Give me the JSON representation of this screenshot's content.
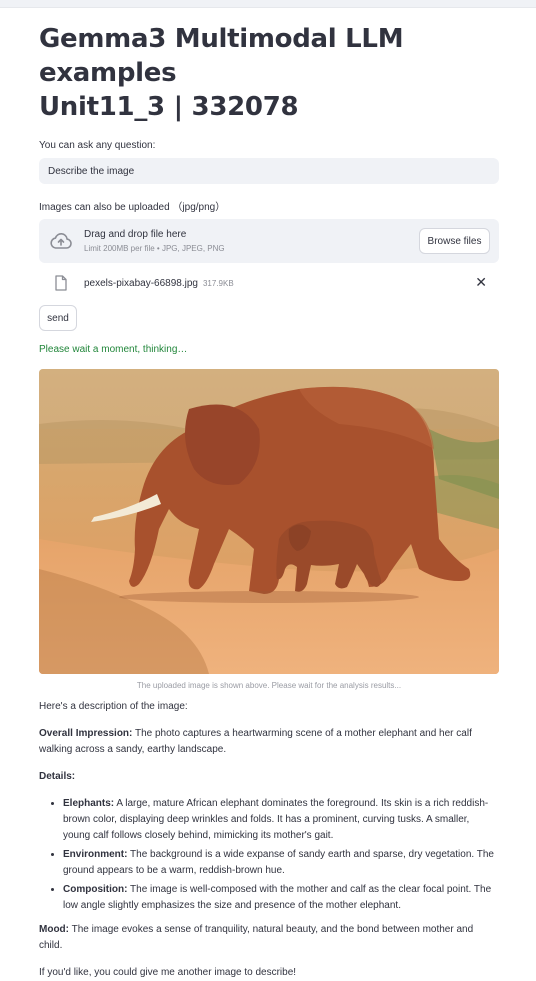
{
  "header": {
    "title_line1": "Gemma3 Multimodal LLM examples",
    "title_line2": "Unit11_3 | 332078"
  },
  "question": {
    "label": "You can ask any question:",
    "value": "Describe the image"
  },
  "uploader": {
    "label": "Images can also be uploaded （jpg/png）",
    "drag_text": "Drag and drop file here",
    "limit_text": "Limit 200MB per file • JPG, JPEG, PNG",
    "browse_label": "Browse files",
    "file_name": "pexels-pixabay-66898.jpg",
    "file_size": "317.9KB",
    "cloud_icon": "cloud-upload-icon",
    "file_icon": "file-icon",
    "close_icon": "close-icon"
  },
  "send_label": "send",
  "status_text": "Please wait a moment, thinking…",
  "image_caption": "The uploaded image is shown above. Please wait for the analysis results...",
  "response": {
    "intro": "Here's a description of the image:",
    "overall_label": "Overall Impression:",
    "overall_text": " The photo captures a heartwarming scene of a mother elephant and her calf walking across a sandy, earthy landscape.",
    "details_label": "Details:",
    "bullets": [
      {
        "label": "Elephants:",
        "text": " A large, mature African elephant dominates the foreground. Its skin is a rich reddish-brown color, displaying deep wrinkles and folds. It has a prominent, curving tusks. A smaller, young calf follows closely behind, mimicking its mother's gait."
      },
      {
        "label": "Environment:",
        "text": " The background is a wide expanse of sandy earth and sparse, dry vegetation. The ground appears to be a warm, reddish-brown hue."
      },
      {
        "label": "Composition:",
        "text": " The image is well-composed with the mother and calf as the clear focal point. The low angle slightly emphasizes the size and presence of the mother elephant."
      }
    ],
    "mood_label": "Mood:",
    "mood_text": " The image evokes a sense of tranquility, natural beauty, and the bond between mother and child.",
    "closing": "If you'd like, you could give me another image to describe!"
  },
  "colors": {
    "status_green": "#21863a",
    "input_bg": "#f0f2f6",
    "text": "#31333f"
  }
}
